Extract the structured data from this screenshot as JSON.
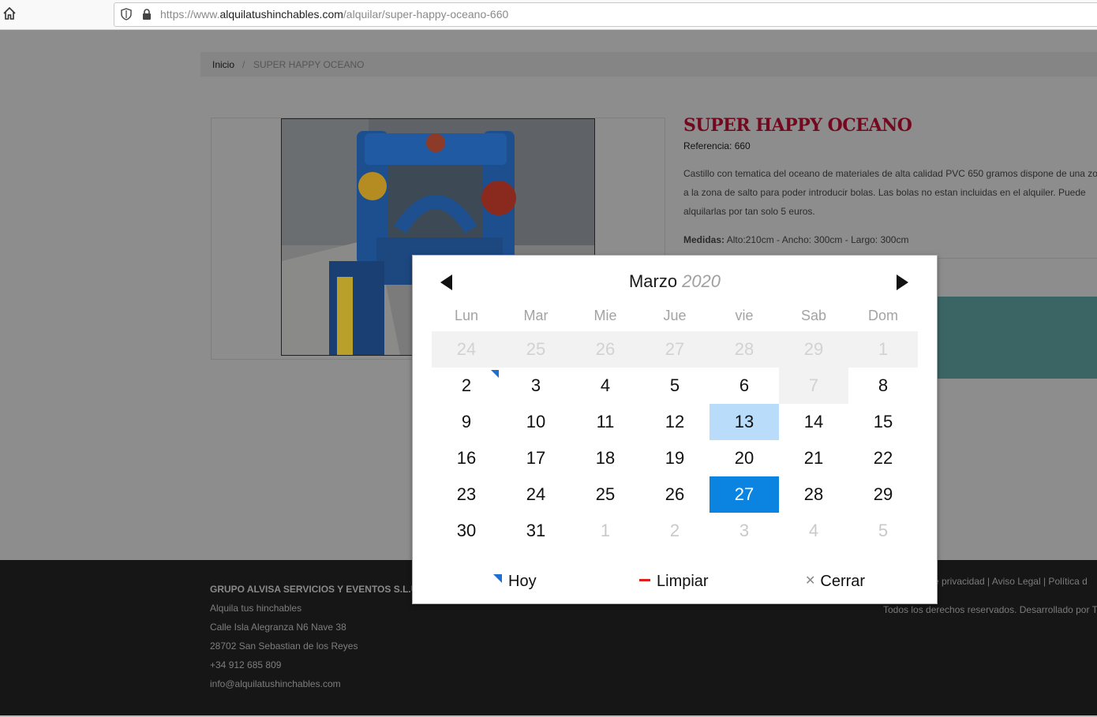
{
  "browser": {
    "url_prefix": "https://www.",
    "url_domain": "alquilatushinchables.com",
    "url_path": "/alquilar/super-happy-oceano-660"
  },
  "breadcrumb": {
    "home": "Inicio",
    "separator": "/",
    "current": "SUPER HAPPY OCEANO"
  },
  "product": {
    "title": "SUPER HAPPY OCEANO",
    "reference": "Referencia: 660",
    "description_lines": [
      "Castillo con tematica del oceano de materiales de alta calidad PVC 650 gramos dispone de una zo",
      "a la zona de salto para poder introducir bolas. Las bolas no estan incluidas en el alquiler. Puede",
      "alquilarlas por tan solo 5 euros."
    ],
    "measures_label": "Medidas:",
    "measures_value": " Alto:210cm - Ancho: 300cm - Largo: 300cm"
  },
  "footer": {
    "lines": [
      "GRUPO ALVISA SERVICIOS Y EVENTOS S.L.U",
      "Alquila tus hinchables",
      "Calle Isla Alegranza N6 Nave 38",
      "28702 San Sebastian de los Reyes",
      "+34 912 685 809",
      "info@alquilatushinchables.com"
    ],
    "links": "e privacidad | Aviso Legal | Política d",
    "rights": "Todos los derechos reservados. Desarrollado por T"
  },
  "datepicker": {
    "month": "Marzo",
    "year": "2020",
    "weekdays": [
      "Lun",
      "Mar",
      "Mie",
      "Jue",
      "vie",
      "Sab",
      "Dom"
    ],
    "weeks": [
      [
        {
          "d": "24",
          "s": "disabled"
        },
        {
          "d": "25",
          "s": "disabled"
        },
        {
          "d": "26",
          "s": "disabled"
        },
        {
          "d": "27",
          "s": "disabled"
        },
        {
          "d": "28",
          "s": "disabled"
        },
        {
          "d": "29",
          "s": "disabled"
        },
        {
          "d": "1",
          "s": "disabled"
        }
      ],
      [
        {
          "d": "2",
          "s": "today"
        },
        {
          "d": "3"
        },
        {
          "d": "4"
        },
        {
          "d": "5"
        },
        {
          "d": "6"
        },
        {
          "d": "7",
          "s": "disabled"
        },
        {
          "d": "8"
        }
      ],
      [
        {
          "d": "9"
        },
        {
          "d": "10"
        },
        {
          "d": "11"
        },
        {
          "d": "12"
        },
        {
          "d": "13",
          "s": "focus"
        },
        {
          "d": "14"
        },
        {
          "d": "15"
        }
      ],
      [
        {
          "d": "16"
        },
        {
          "d": "17"
        },
        {
          "d": "18"
        },
        {
          "d": "19"
        },
        {
          "d": "20"
        },
        {
          "d": "21"
        },
        {
          "d": "22"
        }
      ],
      [
        {
          "d": "23"
        },
        {
          "d": "24"
        },
        {
          "d": "25"
        },
        {
          "d": "26"
        },
        {
          "d": "27",
          "s": "selected"
        },
        {
          "d": "28"
        },
        {
          "d": "29"
        }
      ],
      [
        {
          "d": "30"
        },
        {
          "d": "31"
        },
        {
          "d": "1",
          "s": "out"
        },
        {
          "d": "2",
          "s": "out"
        },
        {
          "d": "3",
          "s": "out"
        },
        {
          "d": "4",
          "s": "out"
        },
        {
          "d": "5",
          "s": "out"
        }
      ]
    ],
    "today_label": "Hoy",
    "clear_label": "Limpiar",
    "close_label": "Cerrar",
    "colors": {
      "selected": "#0a84e0",
      "focus": "#b8dcfa",
      "today_marker": "#1f6fd1",
      "clear_marker": "#e0201a"
    }
  }
}
